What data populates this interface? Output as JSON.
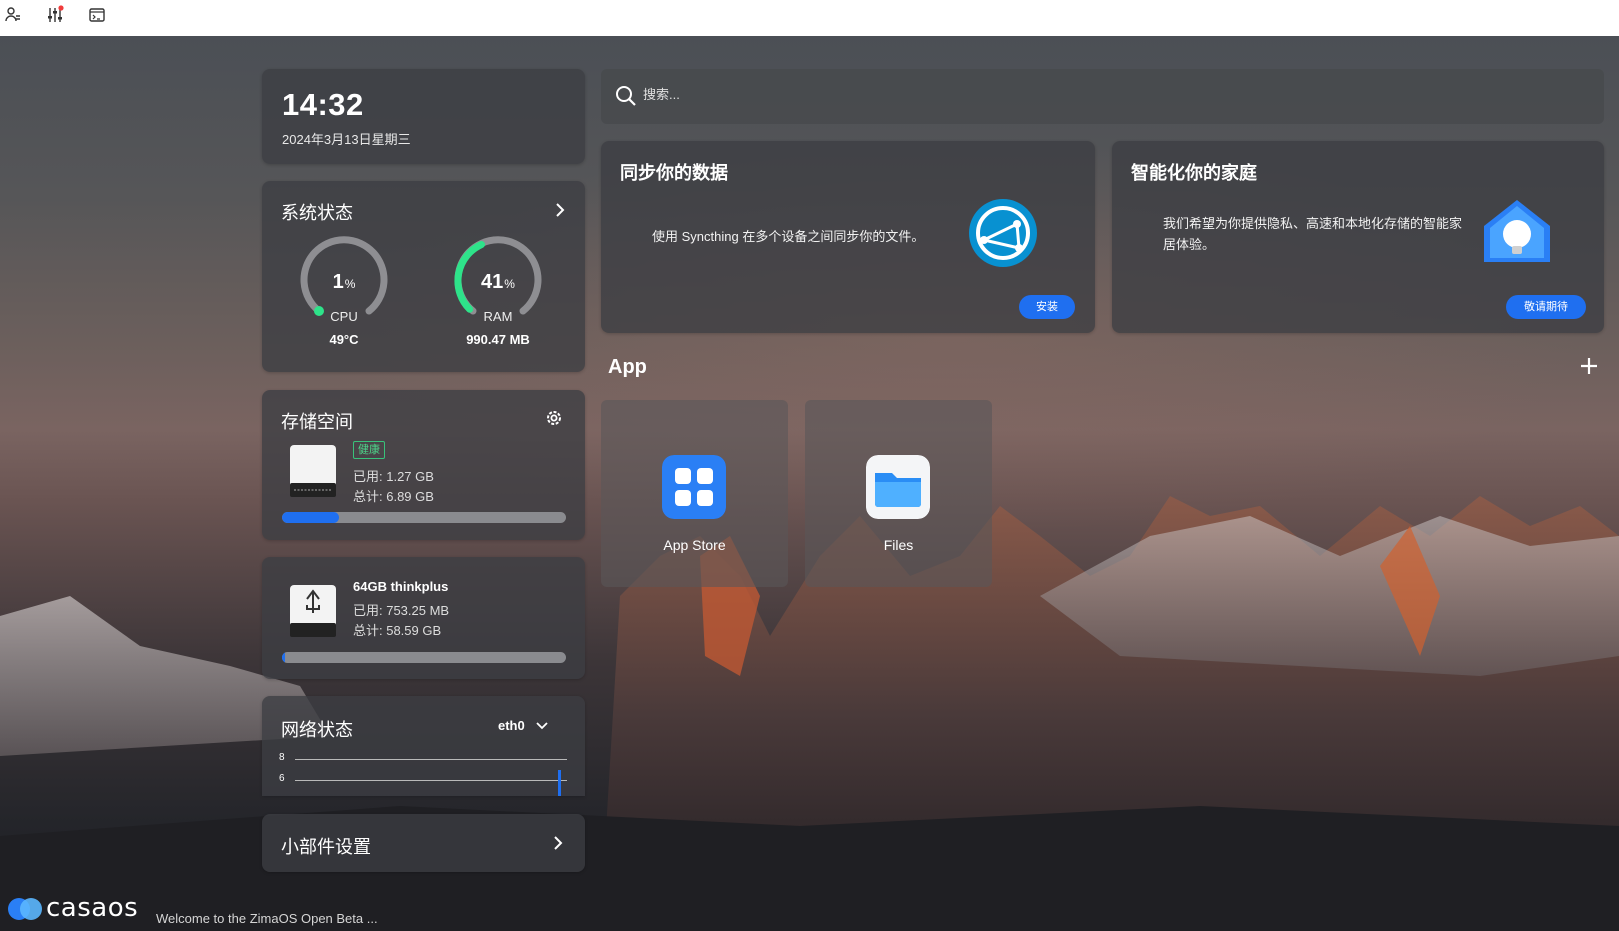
{
  "topbar": {
    "icons": [
      "user-icon",
      "settings-sliders-icon",
      "terminal-icon"
    ]
  },
  "clock": {
    "time": "14:32",
    "date": "2024年3月13日星期三"
  },
  "system_status": {
    "title": "系统状态",
    "cpu": {
      "value": "1",
      "unit": "%",
      "label": "CPU",
      "temp": "49°C",
      "fraction": 0.01
    },
    "ram": {
      "value": "41",
      "unit": "%",
      "label": "RAM",
      "used": "990.47 MB",
      "fraction": 0.41
    },
    "accent_color": "#2ee38a"
  },
  "storage": {
    "title": "存储空间",
    "disk": {
      "badge": "健康",
      "used": "已用: 1.27 GB",
      "total": "总计: 6.89 GB",
      "fraction": 0.2
    },
    "usb": {
      "name": "64GB thinkplus",
      "used": "已用: 753.25 MB",
      "total": "总计: 58.59 GB",
      "fraction": 0.01
    }
  },
  "network": {
    "title": "网络状态",
    "interface": "eth0",
    "y_ticks": [
      "8",
      "6"
    ]
  },
  "widget_settings": {
    "title": "小部件设置"
  },
  "search": {
    "placeholder": "搜索..."
  },
  "promos": [
    {
      "title": "同步你的数据",
      "desc": "使用 Syncthing 在多个设备之间同步你的文件。",
      "button": "安装"
    },
    {
      "title": "智能化你的家庭",
      "desc": "我们希望为你提供隐私、高速和本地化存储的智能家居体验。",
      "button": "敬请期待"
    }
  ],
  "apps": {
    "title": "App",
    "items": [
      {
        "name": "App Store",
        "icon": "app-store-icon"
      },
      {
        "name": "Files",
        "icon": "folder-icon"
      }
    ]
  },
  "footer": {
    "brand": "casaos",
    "message": "Welcome to the ZimaOS Open Beta ..."
  },
  "colors": {
    "accent_blue": "#1f6ff0",
    "health_green": "#39c27a"
  }
}
